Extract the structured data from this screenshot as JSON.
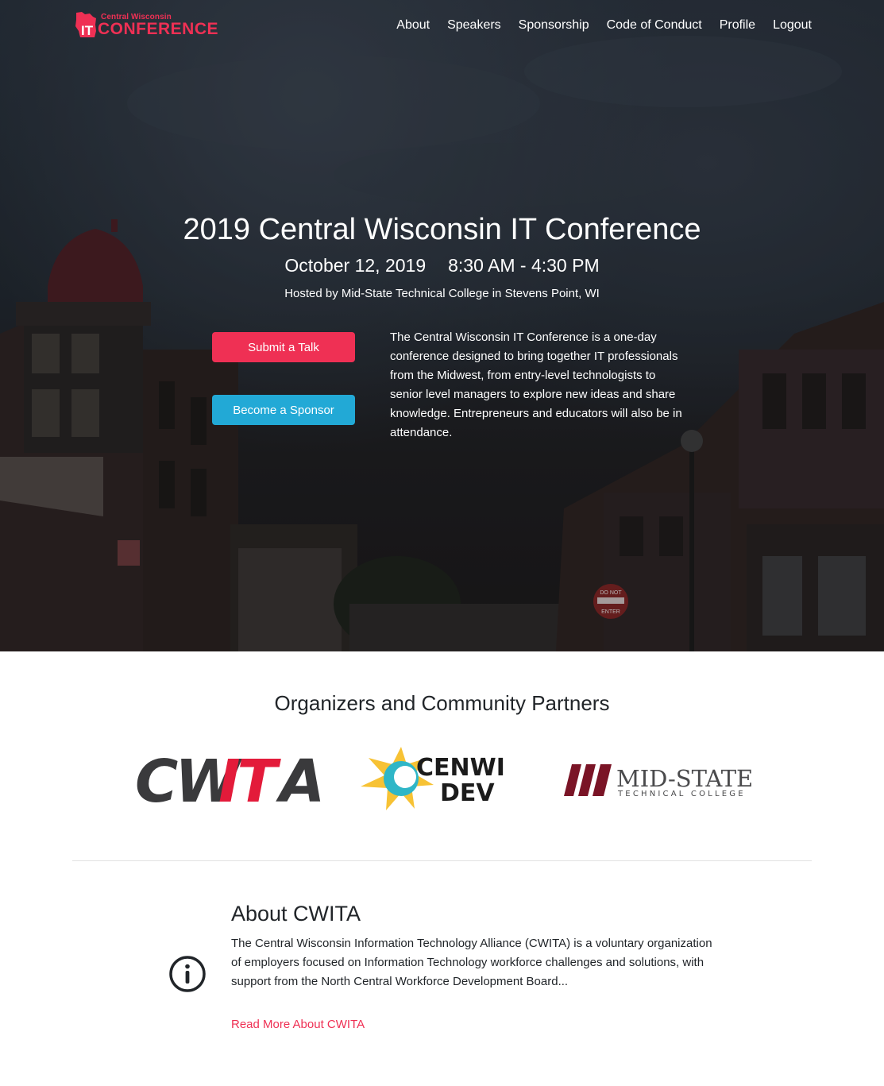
{
  "nav": {
    "logo_small": "Central Wisconsin",
    "logo_big": "CONFERENCE",
    "logo_it": "IT",
    "items": [
      {
        "label": "About"
      },
      {
        "label": "Speakers"
      },
      {
        "label": "Sponsorship"
      },
      {
        "label": "Code of Conduct"
      },
      {
        "label": "Profile"
      },
      {
        "label": "Logout"
      }
    ]
  },
  "hero": {
    "title": "2019 Central Wisconsin IT Conference",
    "date": "October 12, 2019",
    "time": "8:30 AM - 4:30 PM",
    "host": "Hosted by Mid-State Technical College in Stevens Point, WI",
    "submit_label": "Submit a Talk",
    "sponsor_label": "Become a Sponsor",
    "description": "The Central Wisconsin IT Conference is a one-day conference designed to bring together IT professionals from the Midwest, from entry-level technologists to senior level managers to explore new ideas and share knowledge. Entrepreneurs and educators will also be in attendance.",
    "sign_text_1": "DO NOT",
    "sign_text_2": "ENTER"
  },
  "partners": {
    "title": "Organizers and Community Partners",
    "logos": [
      {
        "name": "CWITA",
        "text_1": "CW",
        "text_2": "IT",
        "text_3": "A"
      },
      {
        "name": "CENWI DEV",
        "text_1": "CENWI",
        "text_2": "DEV"
      },
      {
        "name": "MID-STATE TECHNICAL COLLEGE",
        "text_1": "MID-STATE",
        "text_2": "TECHNICAL COLLEGE"
      }
    ]
  },
  "about": {
    "title": "About CWITA",
    "text": "The Central Wisconsin Information Technology Alliance (CWITA) is a voluntary organization of employers focused on Information Technology workforce challenges and solutions, with support from the North Central Workforce Development Board...",
    "link_label": "Read More About CWITA"
  },
  "colors": {
    "accent_red": "#ef3054",
    "accent_blue": "#22a9d6",
    "cwita_red": "#e31b3a",
    "mid_state_maroon": "#7a1426"
  },
  "icons": [
    "wisconsin-logo-icon",
    "info-icon"
  ]
}
